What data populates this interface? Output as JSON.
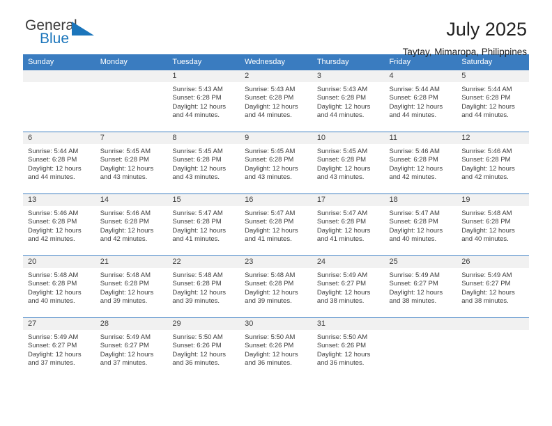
{
  "brand": {
    "name_part1": "General",
    "name_part2": "Blue",
    "triangle_color": "#1b75bb"
  },
  "header": {
    "title": "July 2025",
    "subtitle": "Taytay, Mimaropa, Philippines"
  },
  "theme": {
    "header_blue": "#3a7cc0",
    "band_gray": "#f1f1f1",
    "text": "#3c3c3c"
  },
  "weekday_headers": [
    "Sunday",
    "Monday",
    "Tuesday",
    "Wednesday",
    "Thursday",
    "Friday",
    "Saturday"
  ],
  "weeks": [
    [
      {
        "day": "",
        "sunrise": "",
        "sunset": "",
        "daylight_line1": "",
        "daylight_line2": ""
      },
      {
        "day": "",
        "sunrise": "",
        "sunset": "",
        "daylight_line1": "",
        "daylight_line2": ""
      },
      {
        "day": "1",
        "sunrise": "Sunrise: 5:43 AM",
        "sunset": "Sunset: 6:28 PM",
        "daylight_line1": "Daylight: 12 hours",
        "daylight_line2": "and 44 minutes."
      },
      {
        "day": "2",
        "sunrise": "Sunrise: 5:43 AM",
        "sunset": "Sunset: 6:28 PM",
        "daylight_line1": "Daylight: 12 hours",
        "daylight_line2": "and 44 minutes."
      },
      {
        "day": "3",
        "sunrise": "Sunrise: 5:43 AM",
        "sunset": "Sunset: 6:28 PM",
        "daylight_line1": "Daylight: 12 hours",
        "daylight_line2": "and 44 minutes."
      },
      {
        "day": "4",
        "sunrise": "Sunrise: 5:44 AM",
        "sunset": "Sunset: 6:28 PM",
        "daylight_line1": "Daylight: 12 hours",
        "daylight_line2": "and 44 minutes."
      },
      {
        "day": "5",
        "sunrise": "Sunrise: 5:44 AM",
        "sunset": "Sunset: 6:28 PM",
        "daylight_line1": "Daylight: 12 hours",
        "daylight_line2": "and 44 minutes."
      }
    ],
    [
      {
        "day": "6",
        "sunrise": "Sunrise: 5:44 AM",
        "sunset": "Sunset: 6:28 PM",
        "daylight_line1": "Daylight: 12 hours",
        "daylight_line2": "and 44 minutes."
      },
      {
        "day": "7",
        "sunrise": "Sunrise: 5:45 AM",
        "sunset": "Sunset: 6:28 PM",
        "daylight_line1": "Daylight: 12 hours",
        "daylight_line2": "and 43 minutes."
      },
      {
        "day": "8",
        "sunrise": "Sunrise: 5:45 AM",
        "sunset": "Sunset: 6:28 PM",
        "daylight_line1": "Daylight: 12 hours",
        "daylight_line2": "and 43 minutes."
      },
      {
        "day": "9",
        "sunrise": "Sunrise: 5:45 AM",
        "sunset": "Sunset: 6:28 PM",
        "daylight_line1": "Daylight: 12 hours",
        "daylight_line2": "and 43 minutes."
      },
      {
        "day": "10",
        "sunrise": "Sunrise: 5:45 AM",
        "sunset": "Sunset: 6:28 PM",
        "daylight_line1": "Daylight: 12 hours",
        "daylight_line2": "and 43 minutes."
      },
      {
        "day": "11",
        "sunrise": "Sunrise: 5:46 AM",
        "sunset": "Sunset: 6:28 PM",
        "daylight_line1": "Daylight: 12 hours",
        "daylight_line2": "and 42 minutes."
      },
      {
        "day": "12",
        "sunrise": "Sunrise: 5:46 AM",
        "sunset": "Sunset: 6:28 PM",
        "daylight_line1": "Daylight: 12 hours",
        "daylight_line2": "and 42 minutes."
      }
    ],
    [
      {
        "day": "13",
        "sunrise": "Sunrise: 5:46 AM",
        "sunset": "Sunset: 6:28 PM",
        "daylight_line1": "Daylight: 12 hours",
        "daylight_line2": "and 42 minutes."
      },
      {
        "day": "14",
        "sunrise": "Sunrise: 5:46 AM",
        "sunset": "Sunset: 6:28 PM",
        "daylight_line1": "Daylight: 12 hours",
        "daylight_line2": "and 42 minutes."
      },
      {
        "day": "15",
        "sunrise": "Sunrise: 5:47 AM",
        "sunset": "Sunset: 6:28 PM",
        "daylight_line1": "Daylight: 12 hours",
        "daylight_line2": "and 41 minutes."
      },
      {
        "day": "16",
        "sunrise": "Sunrise: 5:47 AM",
        "sunset": "Sunset: 6:28 PM",
        "daylight_line1": "Daylight: 12 hours",
        "daylight_line2": "and 41 minutes."
      },
      {
        "day": "17",
        "sunrise": "Sunrise: 5:47 AM",
        "sunset": "Sunset: 6:28 PM",
        "daylight_line1": "Daylight: 12 hours",
        "daylight_line2": "and 41 minutes."
      },
      {
        "day": "18",
        "sunrise": "Sunrise: 5:47 AM",
        "sunset": "Sunset: 6:28 PM",
        "daylight_line1": "Daylight: 12 hours",
        "daylight_line2": "and 40 minutes."
      },
      {
        "day": "19",
        "sunrise": "Sunrise: 5:48 AM",
        "sunset": "Sunset: 6:28 PM",
        "daylight_line1": "Daylight: 12 hours",
        "daylight_line2": "and 40 minutes."
      }
    ],
    [
      {
        "day": "20",
        "sunrise": "Sunrise: 5:48 AM",
        "sunset": "Sunset: 6:28 PM",
        "daylight_line1": "Daylight: 12 hours",
        "daylight_line2": "and 40 minutes."
      },
      {
        "day": "21",
        "sunrise": "Sunrise: 5:48 AM",
        "sunset": "Sunset: 6:28 PM",
        "daylight_line1": "Daylight: 12 hours",
        "daylight_line2": "and 39 minutes."
      },
      {
        "day": "22",
        "sunrise": "Sunrise: 5:48 AM",
        "sunset": "Sunset: 6:28 PM",
        "daylight_line1": "Daylight: 12 hours",
        "daylight_line2": "and 39 minutes."
      },
      {
        "day": "23",
        "sunrise": "Sunrise: 5:48 AM",
        "sunset": "Sunset: 6:28 PM",
        "daylight_line1": "Daylight: 12 hours",
        "daylight_line2": "and 39 minutes."
      },
      {
        "day": "24",
        "sunrise": "Sunrise: 5:49 AM",
        "sunset": "Sunset: 6:27 PM",
        "daylight_line1": "Daylight: 12 hours",
        "daylight_line2": "and 38 minutes."
      },
      {
        "day": "25",
        "sunrise": "Sunrise: 5:49 AM",
        "sunset": "Sunset: 6:27 PM",
        "daylight_line1": "Daylight: 12 hours",
        "daylight_line2": "and 38 minutes."
      },
      {
        "day": "26",
        "sunrise": "Sunrise: 5:49 AM",
        "sunset": "Sunset: 6:27 PM",
        "daylight_line1": "Daylight: 12 hours",
        "daylight_line2": "and 38 minutes."
      }
    ],
    [
      {
        "day": "27",
        "sunrise": "Sunrise: 5:49 AM",
        "sunset": "Sunset: 6:27 PM",
        "daylight_line1": "Daylight: 12 hours",
        "daylight_line2": "and 37 minutes."
      },
      {
        "day": "28",
        "sunrise": "Sunrise: 5:49 AM",
        "sunset": "Sunset: 6:27 PM",
        "daylight_line1": "Daylight: 12 hours",
        "daylight_line2": "and 37 minutes."
      },
      {
        "day": "29",
        "sunrise": "Sunrise: 5:50 AM",
        "sunset": "Sunset: 6:26 PM",
        "daylight_line1": "Daylight: 12 hours",
        "daylight_line2": "and 36 minutes."
      },
      {
        "day": "30",
        "sunrise": "Sunrise: 5:50 AM",
        "sunset": "Sunset: 6:26 PM",
        "daylight_line1": "Daylight: 12 hours",
        "daylight_line2": "and 36 minutes."
      },
      {
        "day": "31",
        "sunrise": "Sunrise: 5:50 AM",
        "sunset": "Sunset: 6:26 PM",
        "daylight_line1": "Daylight: 12 hours",
        "daylight_line2": "and 36 minutes."
      },
      {
        "day": "",
        "sunrise": "",
        "sunset": "",
        "daylight_line1": "",
        "daylight_line2": ""
      },
      {
        "day": "",
        "sunrise": "",
        "sunset": "",
        "daylight_line1": "",
        "daylight_line2": ""
      }
    ]
  ]
}
